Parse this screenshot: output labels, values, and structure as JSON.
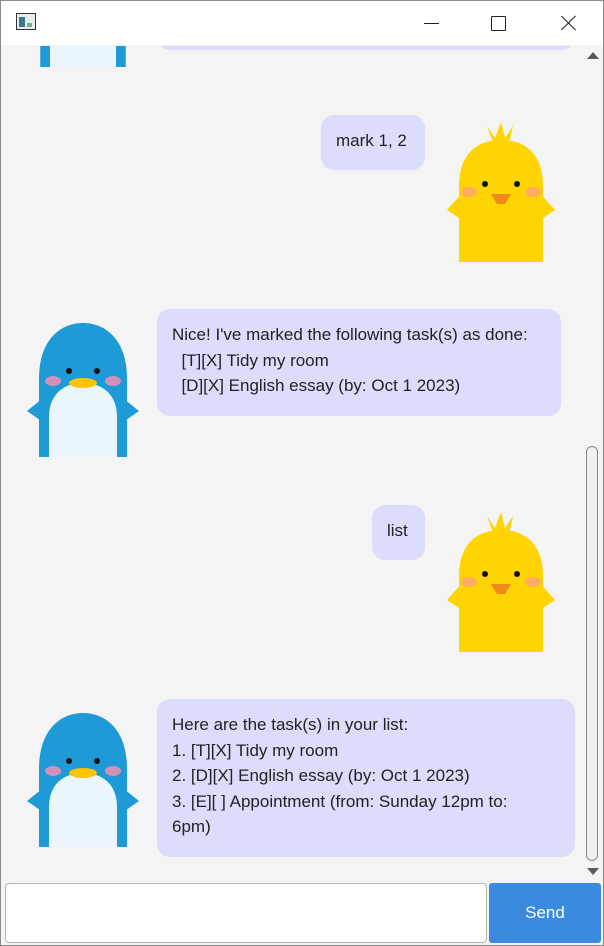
{
  "window": {
    "icons": {
      "app": "app-window-icon",
      "minimize": "minimize-icon",
      "maximize": "maximize-icon",
      "close": "close-icon"
    }
  },
  "messages": [
    {
      "sender": "user",
      "text": "mark 1, 2"
    },
    {
      "sender": "bot",
      "text": "Nice! I've marked the following task(s) as done:\n  [T][X] Tidy my room\n  [D][X] English essay (by: Oct 1 2023)"
    },
    {
      "sender": "user",
      "text": "list"
    },
    {
      "sender": "bot",
      "text": "Here are the task(s) in your list:\n1. [T][X] Tidy my room\n2. [D][X] English essay (by: Oct 1 2023)\n3. [E][ ] Appointment (from: Sunday 12pm to:\n6pm)"
    }
  ],
  "avatars": {
    "user": "chick-avatar",
    "bot": "penguin-avatar"
  },
  "colors": {
    "bubble": "#dcdcfc",
    "send_button": "#3a8ae0",
    "chick": "#ffd400",
    "penguin": "#1e9ad6"
  },
  "input": {
    "value": "",
    "placeholder": ""
  },
  "send_label": "Send"
}
